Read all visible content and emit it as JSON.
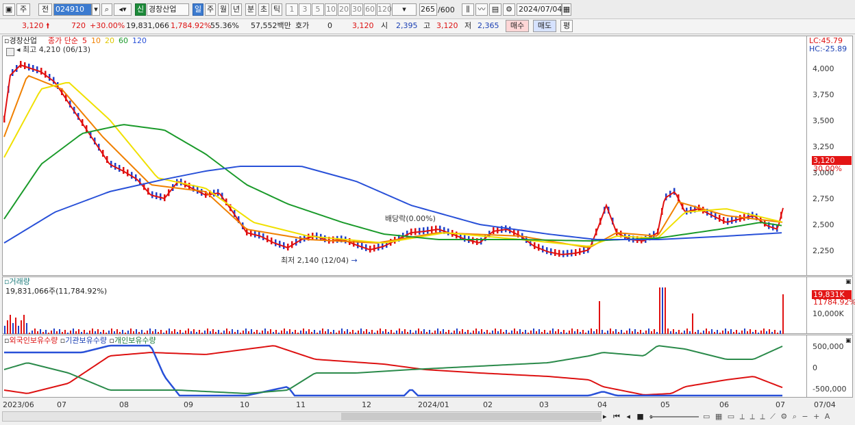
{
  "toolbar": {
    "period_btn": "주",
    "prev_btn": "전",
    "code": "024910",
    "new_badge": "신",
    "stock_name": "경창산업",
    "periods": [
      "일",
      "주",
      "월",
      "년",
      "분",
      "초",
      "틱"
    ],
    "numbers": [
      "1",
      "3",
      "5",
      "10",
      "20",
      "30",
      "60",
      "120"
    ],
    "count": "265",
    "count_total": "/600",
    "date": "2024/07/04"
  },
  "quote": {
    "price": "3,120",
    "change": "720",
    "change_pct": "+30.00%",
    "volume": "19,831,066",
    "volume_pct": "1,784.92%",
    "turnover": "55.36%",
    "amount": "57,552백만",
    "quote_label": "호가",
    "quote_val": "0",
    "quote_price": "3,120",
    "open_label": "시",
    "open": "2,395",
    "high_label": "고",
    "high": "3,120",
    "low_label": "저",
    "low": "2,365",
    "buy": "매수",
    "sell": "매도",
    "eval": "평"
  },
  "price_panel": {
    "name": "경창산업",
    "ma_label": "종가 단순",
    "ma_periods": [
      "5",
      "10",
      "20",
      "60",
      "120"
    ],
    "high_note": "최고 4,210 (06/13)",
    "low_note": "최저 2,140 (12/04)",
    "dividend_note": "배당락(0.00%)",
    "lc": "LC:45.79",
    "hc": "HC:-25.89",
    "yticks": [
      "4,000",
      "3,750",
      "3,500",
      "3,250",
      "3,000",
      "2,750",
      "2,500",
      "2,250"
    ],
    "last_tag": "3,120",
    "last_pct": "30.00%"
  },
  "volume_panel": {
    "title": "거래량",
    "value": "19,831,066주(11,784.92%)",
    "tag": "19,831K",
    "pct": "11784.92%",
    "ytick": "10,000K"
  },
  "holdings_panel": {
    "foreign": "외국인보유수량",
    "inst": "기관보유수량",
    "indiv": "개인보유수량",
    "yticks": [
      "500,000",
      "0",
      "-500,000"
    ]
  },
  "xaxis": [
    "2023/06",
    "07",
    "08",
    "09",
    "10",
    "11",
    "12",
    "2024/01",
    "02",
    "03",
    "04",
    "05",
    "06",
    "07"
  ],
  "xaxis_right": "07/04",
  "colors": {
    "ma5": "#e01010",
    "ma10": "#f08000",
    "ma20": "#f0e000",
    "ma60": "#1a9a2a",
    "ma120": "#2850d8",
    "up": "#e01010",
    "down": "#2040c8"
  }
}
